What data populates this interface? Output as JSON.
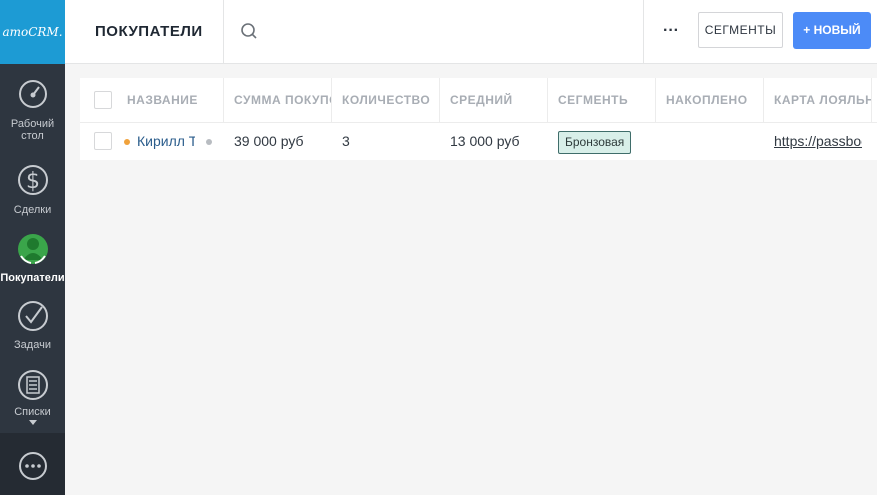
{
  "sidebar": {
    "logo": "amoCRM.",
    "items": [
      {
        "label": "Рабочий стол",
        "line1": "Рабочий",
        "line2": "стол",
        "icon": "dashboard-icon"
      },
      {
        "label": "Сделки",
        "icon": "dollar-icon"
      },
      {
        "label": "Покупатели",
        "icon": "customers-icon",
        "active": true
      },
      {
        "label": "Задачи",
        "icon": "checkmark-icon"
      },
      {
        "label": "Списки",
        "icon": "list-icon"
      }
    ],
    "chat_icon": "chat-icon"
  },
  "header": {
    "title": "ПОКУПАТЕЛИ",
    "search_icon": "search-icon",
    "more_label": "···",
    "segments_label": "СЕГМЕНТЫ",
    "new_label": "+ НОВЫЙ"
  },
  "table": {
    "columns": [
      "НАЗВАНИЕ",
      "СУММА ПОКУПОК",
      "КОЛИЧЕСТВО",
      "СРЕДНИЙ",
      "СЕГМЕНТЬ",
      "НАКОПЛЕНО",
      "КАРТА ЛОЯЛЬНОСТИ"
    ],
    "rows": [
      {
        "name": "Кирилл Т",
        "sum": "39 000 руб",
        "count": "3",
        "avg": "13 000 руб",
        "segment": "Бронзовая",
        "accumulated": "",
        "card": "https://passbook"
      }
    ]
  },
  "colors": {
    "accent": "#4c8bf7",
    "logo_bg": "#1d9bd4",
    "sidebar_bg": "#2e3640",
    "customers_green": "#3aa54a",
    "status_dot": "#f0a23c"
  }
}
